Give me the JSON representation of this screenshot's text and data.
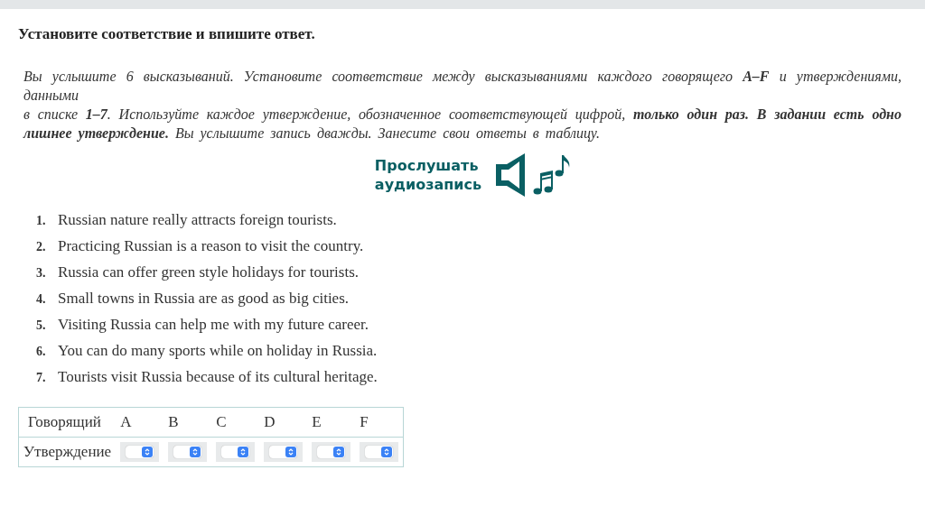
{
  "task_title": "Установите соответствие и впишите ответ.",
  "instructions": [
    "Вы услышите 6 высказываний. Установите соответствие между высказываниями каждого говорящего **A–F** и утверждениями, данными",
    "в списке **1–7**. Используйте каждое утверждение, обозначенное соответствующей цифрой, **только один раз. В задании есть одно лишнее утверждение.** Вы услышите запись дважды. Занесите свои ответы в таблицу."
  ],
  "audio_button": {
    "label_lines": [
      "Прослушать",
      "аудиозапись"
    ]
  },
  "statements": [
    {
      "number": "1.",
      "text": "Russian nature really attracts foreign tourists."
    },
    {
      "number": "2.",
      "text": "Practicing Russian is a reason to visit the country."
    },
    {
      "number": "3.",
      "text": "Russia can offer green style holidays for tourists."
    },
    {
      "number": "4.",
      "text": "Small towns in Russia are as good as big cities."
    },
    {
      "number": "5.",
      "text": "Visiting Russia can help me with my future career."
    },
    {
      "number": "6.",
      "text": "You can do many sports while on holiday in Russia."
    },
    {
      "number": "7.",
      "text": "Tourists visit Russia because of its cultural heritage."
    }
  ],
  "answer_table": {
    "header_label": "Говорящий",
    "row_label": "Утверждение",
    "speakers": [
      "A",
      "B",
      "C",
      "D",
      "E",
      "F"
    ]
  }
}
